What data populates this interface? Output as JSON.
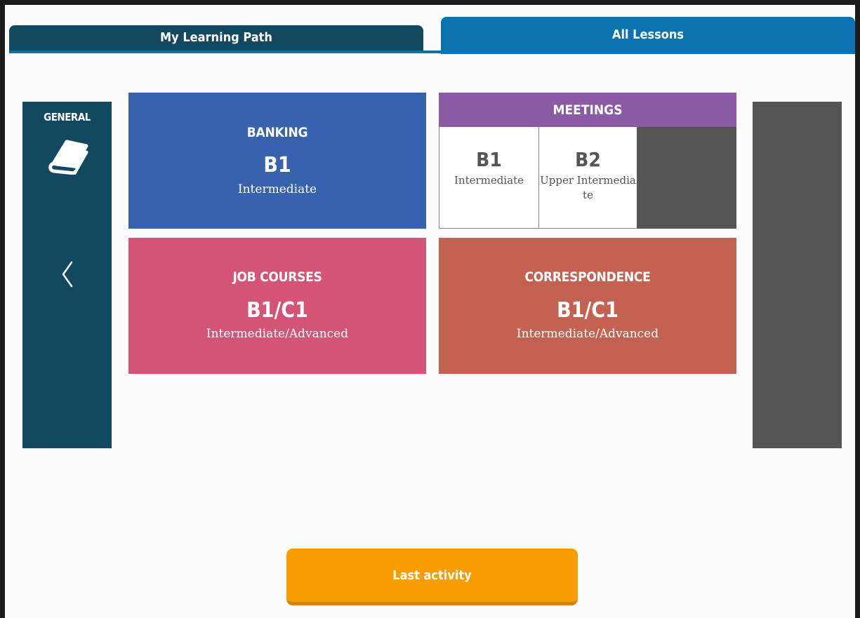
{
  "tabs": {
    "learning_path": "My Learning Path",
    "all_lessons": "All Lessons"
  },
  "sidebar": {
    "category": "GENERAL",
    "icon": "book-icon",
    "prev_icon": "chevron-left-icon"
  },
  "cards": {
    "banking": {
      "title": "BANKING",
      "level": "B1",
      "desc": "Intermediate",
      "color": "#3762ae"
    },
    "meetings": {
      "title": "MEETINGS",
      "color": "#8b5aa5",
      "levels": [
        {
          "level": "B1",
          "desc": "Intermediate"
        },
        {
          "level": "B2",
          "desc": "Upper Intermediate"
        }
      ]
    },
    "job_courses": {
      "title": "JOB COURSES",
      "level": "B1/C1",
      "desc": "Intermediate/Advanced",
      "color": "#d35475"
    },
    "correspondence": {
      "title": "CORRESPONDENCE",
      "level": "B1/C1",
      "desc": "Intermediate/Advanced",
      "color": "#c46251"
    }
  },
  "footer": {
    "last_activity": "Last activity"
  }
}
